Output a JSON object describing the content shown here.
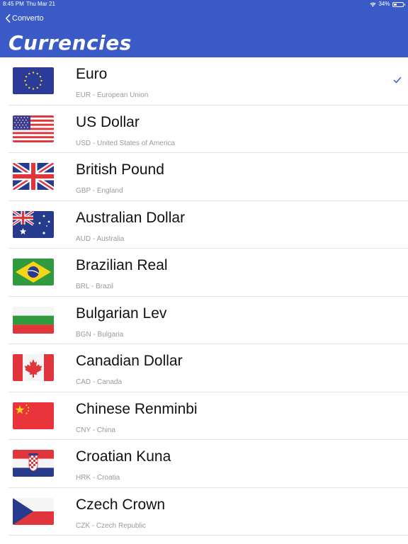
{
  "status_bar": {
    "time": "8:45 PM",
    "date": "Thu Mar 21",
    "battery": "34%",
    "battery_level": 0.34
  },
  "nav": {
    "back_label": "Converto",
    "title": "Currencies"
  },
  "colors": {
    "header": "#3a5bc7",
    "check": "#3a5bc7"
  },
  "currencies": [
    {
      "name": "Euro",
      "subtitle": "EUR - European Union",
      "flag": "eu-flag-icon",
      "selected": true
    },
    {
      "name": "US Dollar",
      "subtitle": "USD - United States of America",
      "flag": "us-flag-icon",
      "selected": false
    },
    {
      "name": "British Pound",
      "subtitle": "GBP - England",
      "flag": "uk-flag-icon",
      "selected": false
    },
    {
      "name": "Australian Dollar",
      "subtitle": "AUD - Australia",
      "flag": "australia-flag-icon",
      "selected": false
    },
    {
      "name": "Brazilian Real",
      "subtitle": "BRL - Brazil",
      "flag": "brazil-flag-icon",
      "selected": false
    },
    {
      "name": "Bulgarian Lev",
      "subtitle": "BGN - Bulgaria",
      "flag": "bulgaria-flag-icon",
      "selected": false
    },
    {
      "name": "Canadian Dollar",
      "subtitle": "CAD - Canada",
      "flag": "canada-flag-icon",
      "selected": false
    },
    {
      "name": "Chinese Renminbi",
      "subtitle": "CNY - China",
      "flag": "china-flag-icon",
      "selected": false
    },
    {
      "name": "Croatian Kuna",
      "subtitle": "HRK - Croatia",
      "flag": "croatia-flag-icon",
      "selected": false
    },
    {
      "name": "Czech Crown",
      "subtitle": "CZK - Czech Republic",
      "flag": "czech-flag-icon",
      "selected": false
    }
  ]
}
